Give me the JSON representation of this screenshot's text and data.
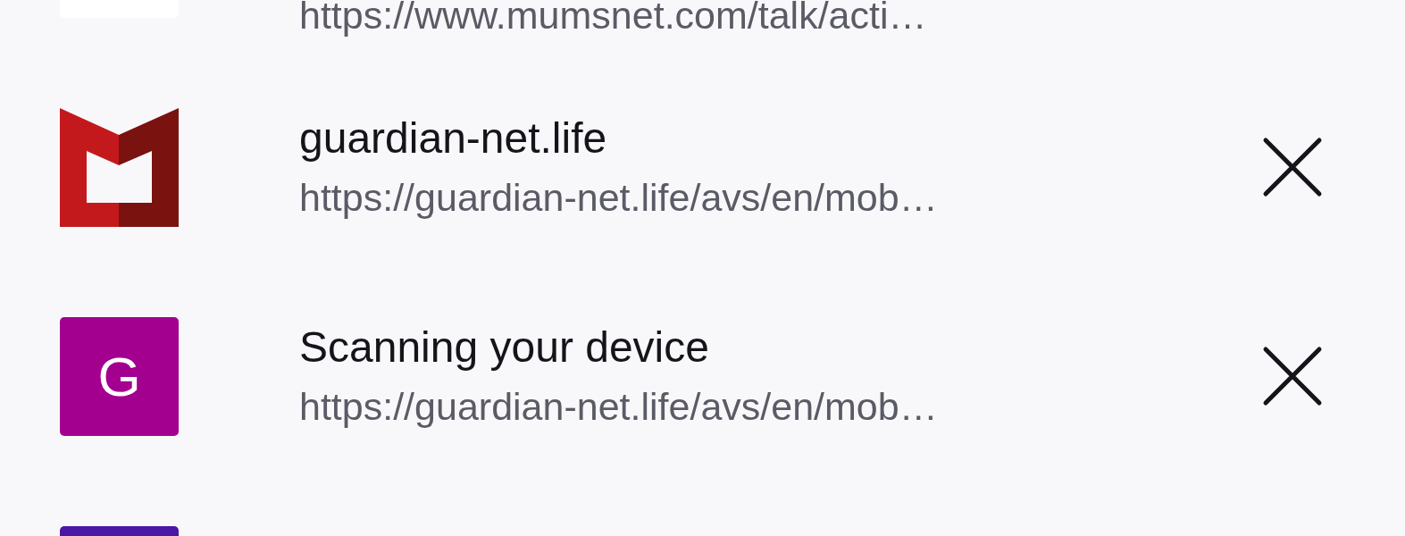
{
  "history": [
    {
      "icon": {
        "kind": "blank",
        "color": "#ffffff"
      },
      "url": "https://www.mumsnet.com/talk/acti…"
    },
    {
      "icon": {
        "kind": "shield",
        "color": "#c4191c"
      },
      "title": "guardian-net.life",
      "url": "https://guardian-net.life/avs/en/mob…",
      "removable": true
    },
    {
      "icon": {
        "kind": "letter",
        "color": "#a3008f",
        "letter": "G"
      },
      "title": "Scanning your device",
      "url": "https://guardian-net.life/avs/en/mob…",
      "removable": true
    },
    {
      "icon": {
        "kind": "blank",
        "color": "#4b17a5"
      }
    }
  ]
}
